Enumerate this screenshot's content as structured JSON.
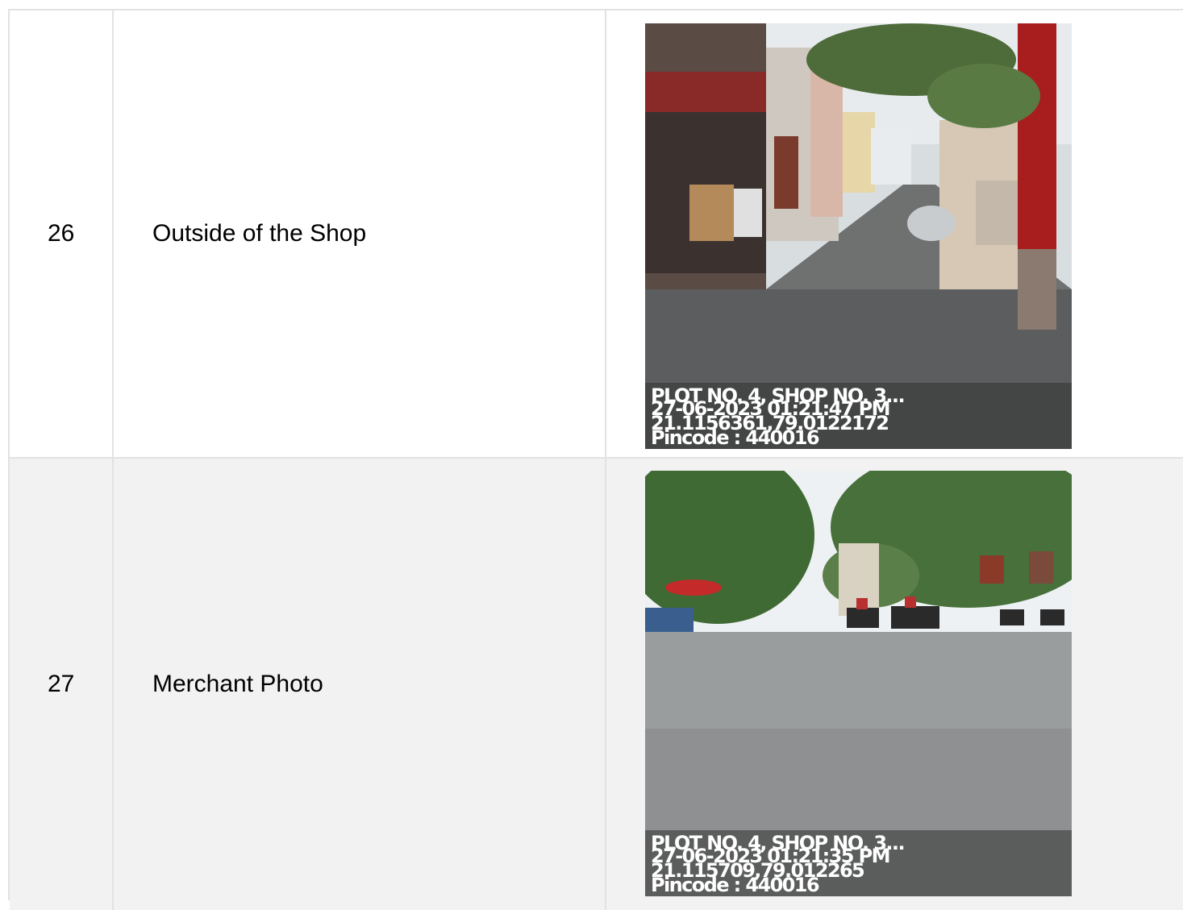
{
  "rows": [
    {
      "number": "26",
      "label": "Outside of the Shop",
      "photo_overlay": {
        "address": "PLOT NO. 4, SHOP NO. 3...",
        "datetime": "27-06-2023 01:21:47 PM",
        "coords": "21.1156361,79.0122172",
        "pincode": "Pincode : 440016"
      }
    },
    {
      "number": "27",
      "label": "Merchant Photo",
      "photo_overlay": {
        "address": "PLOT NO. 4, SHOP NO. 3...",
        "datetime": "27-06-2023 01:21:35 PM",
        "coords": "21.115709,79.012265",
        "pincode": "Pincode : 440016"
      }
    }
  ]
}
